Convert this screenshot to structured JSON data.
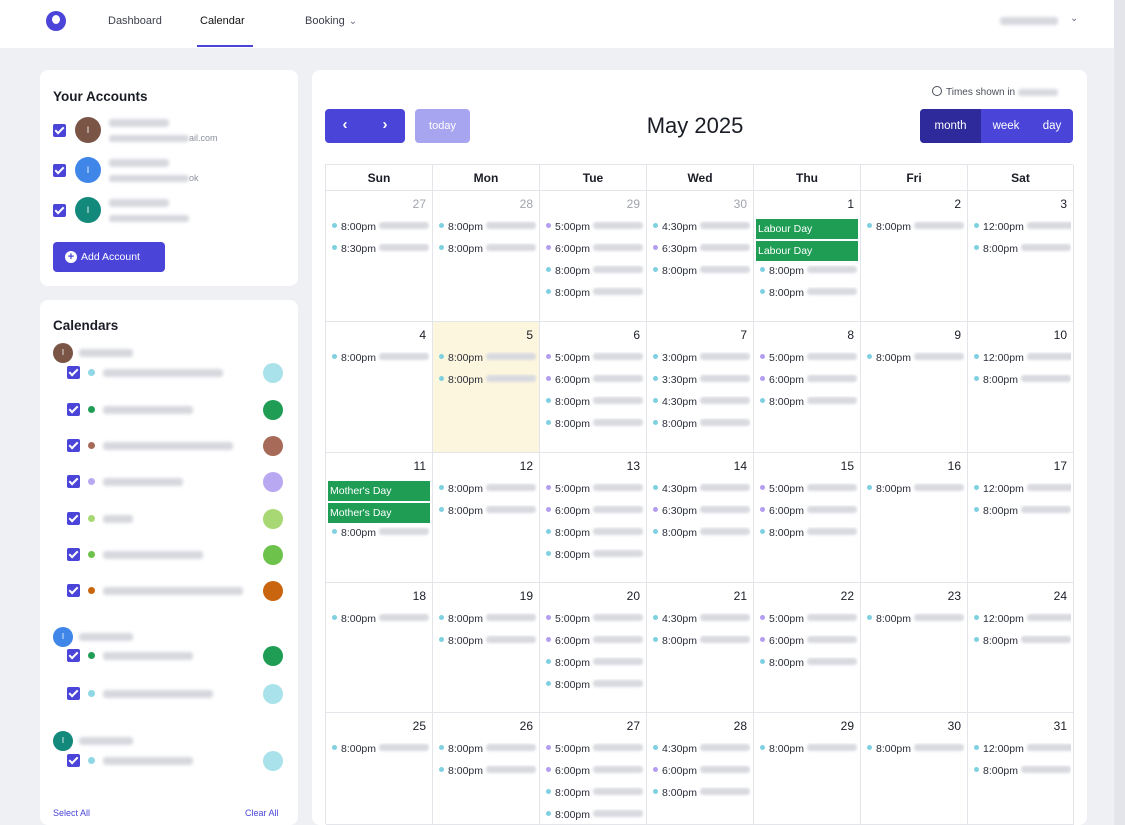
{
  "nav": {
    "dashboard": "Dashboard",
    "calendar": "Calendar",
    "booking": "Booking"
  },
  "accounts": {
    "title": "Your Accounts",
    "items": [
      {
        "initial": "I",
        "color": "#7a5546",
        "email_visible": "ail.com"
      },
      {
        "initial": "I",
        "color": "#3f86e8",
        "email_visible": "ok"
      },
      {
        "initial": "I",
        "color": "#12897b",
        "email_visible": ""
      }
    ],
    "add_label": "Add Account"
  },
  "calendars": {
    "title": "Calendars",
    "groups": [
      {
        "initial": "I",
        "color": "#7a5546",
        "items": [
          {
            "dot": "#8fd7e4",
            "swatch": "#a9e2ea"
          },
          {
            "dot": "#1f9d55",
            "swatch": "#1f9d55"
          },
          {
            "dot": "#a86a58",
            "swatch": "#a86a58"
          },
          {
            "dot": "#b8a8f2",
            "swatch": "#b8a8f2"
          },
          {
            "dot": "#a7d873",
            "swatch": "#a7d873"
          },
          {
            "dot": "#6cc24a",
            "swatch": "#6cc24a"
          },
          {
            "dot": "#c8650e",
            "swatch": "#c8650e"
          }
        ]
      },
      {
        "initial": "I",
        "color": "#3f86e8",
        "items": [
          {
            "dot": "#1f9d55",
            "swatch": "#1f9d55"
          },
          {
            "dot": "#8fd7e4",
            "swatch": "#a9e2ea"
          }
        ]
      },
      {
        "initial": "I",
        "color": "#12897b",
        "items": [
          {
            "dot": "#8fd7e4",
            "swatch": "#a9e2ea"
          }
        ]
      }
    ],
    "select_all": "Select All",
    "clear_all": "Clear All"
  },
  "toolbar": {
    "prev_icon": "chevron-left-icon",
    "next_icon": "chevron-right-icon",
    "prev_glyph": "‹",
    "next_glyph": "›",
    "today": "today",
    "month_title": "May 2025",
    "views": [
      "month",
      "week",
      "day"
    ],
    "active_view": "month",
    "tz_label": "Times shown in"
  },
  "colors": {
    "accent": "#4a45d8",
    "allday_green": "#1f9d55",
    "teal_dot": "#7fd0e0",
    "purple_dot": "#b39df0"
  },
  "weekdays": [
    "Sun",
    "Mon",
    "Tue",
    "Wed",
    "Thu",
    "Fri",
    "Sat"
  ],
  "weeks": [
    [
      {
        "day": "27",
        "other": true,
        "events": [
          {
            "t": "8:00pm",
            "c": "teal"
          },
          {
            "t": "8:30pm",
            "c": "teal"
          }
        ]
      },
      {
        "day": "28",
        "other": true,
        "events": [
          {
            "t": "8:00pm",
            "c": "teal"
          },
          {
            "t": "8:00pm",
            "c": "teal"
          }
        ]
      },
      {
        "day": "29",
        "other": true,
        "events": [
          {
            "t": "5:00pm",
            "c": "purple"
          },
          {
            "t": "6:00pm",
            "c": "purple"
          },
          {
            "t": "8:00pm",
            "c": "teal"
          },
          {
            "t": "8:00pm",
            "c": "teal"
          }
        ]
      },
      {
        "day": "30",
        "other": true,
        "events": [
          {
            "t": "4:30pm",
            "c": "teal"
          },
          {
            "t": "6:30pm",
            "c": "purple"
          },
          {
            "t": "8:00pm",
            "c": "teal"
          }
        ]
      },
      {
        "day": "1",
        "other": false,
        "allday": [
          "Labour Day",
          "Labour Day"
        ],
        "events": [
          {
            "t": "8:00pm",
            "c": "teal"
          },
          {
            "t": "8:00pm",
            "c": "teal"
          }
        ]
      },
      {
        "day": "2",
        "other": false,
        "events": [
          {
            "t": "8:00pm",
            "c": "teal"
          }
        ]
      },
      {
        "day": "3",
        "other": false,
        "events": [
          {
            "t": "12:00pm",
            "c": "teal"
          },
          {
            "t": "8:00pm",
            "c": "teal"
          }
        ]
      }
    ],
    [
      {
        "day": "4",
        "events": [
          {
            "t": "8:00pm",
            "c": "teal"
          }
        ]
      },
      {
        "day": "5",
        "today": true,
        "events": [
          {
            "t": "8:00pm",
            "c": "teal"
          },
          {
            "t": "8:00pm",
            "c": "teal"
          }
        ]
      },
      {
        "day": "6",
        "events": [
          {
            "t": "5:00pm",
            "c": "purple"
          },
          {
            "t": "6:00pm",
            "c": "purple"
          },
          {
            "t": "8:00pm",
            "c": "teal"
          },
          {
            "t": "8:00pm",
            "c": "teal"
          }
        ]
      },
      {
        "day": "7",
        "events": [
          {
            "t": "3:00pm",
            "c": "teal"
          },
          {
            "t": "3:30pm",
            "c": "teal"
          },
          {
            "t": "4:30pm",
            "c": "teal"
          },
          {
            "t": "8:00pm",
            "c": "teal"
          }
        ]
      },
      {
        "day": "8",
        "events": [
          {
            "t": "5:00pm",
            "c": "purple"
          },
          {
            "t": "6:00pm",
            "c": "purple"
          },
          {
            "t": "8:00pm",
            "c": "teal"
          }
        ]
      },
      {
        "day": "9",
        "events": [
          {
            "t": "8:00pm",
            "c": "teal"
          }
        ]
      },
      {
        "day": "10",
        "events": [
          {
            "t": "12:00pm",
            "c": "teal"
          },
          {
            "t": "8:00pm",
            "c": "teal"
          }
        ]
      }
    ],
    [
      {
        "day": "11",
        "allday": [
          "Mother's Day",
          "Mother's Day"
        ],
        "events": [
          {
            "t": "8:00pm",
            "c": "teal"
          }
        ]
      },
      {
        "day": "12",
        "events": [
          {
            "t": "8:00pm",
            "c": "teal"
          },
          {
            "t": "8:00pm",
            "c": "teal"
          }
        ]
      },
      {
        "day": "13",
        "events": [
          {
            "t": "5:00pm",
            "c": "purple"
          },
          {
            "t": "6:00pm",
            "c": "purple"
          },
          {
            "t": "8:00pm",
            "c": "teal"
          },
          {
            "t": "8:00pm",
            "c": "teal"
          }
        ]
      },
      {
        "day": "14",
        "events": [
          {
            "t": "4:30pm",
            "c": "teal"
          },
          {
            "t": "6:30pm",
            "c": "purple"
          },
          {
            "t": "8:00pm",
            "c": "teal"
          }
        ]
      },
      {
        "day": "15",
        "events": [
          {
            "t": "5:00pm",
            "c": "purple"
          },
          {
            "t": "6:00pm",
            "c": "purple"
          },
          {
            "t": "8:00pm",
            "c": "teal"
          }
        ]
      },
      {
        "day": "16",
        "events": [
          {
            "t": "8:00pm",
            "c": "teal"
          }
        ]
      },
      {
        "day": "17",
        "events": [
          {
            "t": "12:00pm",
            "c": "teal"
          },
          {
            "t": "8:00pm",
            "c": "teal"
          }
        ]
      }
    ],
    [
      {
        "day": "18",
        "events": [
          {
            "t": "8:00pm",
            "c": "teal"
          }
        ]
      },
      {
        "day": "19",
        "events": [
          {
            "t": "8:00pm",
            "c": "teal"
          },
          {
            "t": "8:00pm",
            "c": "teal"
          }
        ]
      },
      {
        "day": "20",
        "events": [
          {
            "t": "5:00pm",
            "c": "purple"
          },
          {
            "t": "6:00pm",
            "c": "purple"
          },
          {
            "t": "8:00pm",
            "c": "teal"
          },
          {
            "t": "8:00pm",
            "c": "teal"
          }
        ]
      },
      {
        "day": "21",
        "events": [
          {
            "t": "4:30pm",
            "c": "teal"
          },
          {
            "t": "8:00pm",
            "c": "teal"
          }
        ]
      },
      {
        "day": "22",
        "events": [
          {
            "t": "5:00pm",
            "c": "purple"
          },
          {
            "t": "6:00pm",
            "c": "purple"
          },
          {
            "t": "8:00pm",
            "c": "teal"
          }
        ]
      },
      {
        "day": "23",
        "events": [
          {
            "t": "8:00pm",
            "c": "teal"
          }
        ]
      },
      {
        "day": "24",
        "events": [
          {
            "t": "12:00pm",
            "c": "teal"
          },
          {
            "t": "8:00pm",
            "c": "teal"
          }
        ]
      }
    ],
    [
      {
        "day": "25",
        "events": [
          {
            "t": "8:00pm",
            "c": "teal"
          }
        ]
      },
      {
        "day": "26",
        "events": [
          {
            "t": "8:00pm",
            "c": "teal"
          },
          {
            "t": "8:00pm",
            "c": "teal"
          }
        ]
      },
      {
        "day": "27",
        "events": [
          {
            "t": "5:00pm",
            "c": "purple"
          },
          {
            "t": "6:00pm",
            "c": "purple"
          },
          {
            "t": "8:00pm",
            "c": "teal"
          },
          {
            "t": "8:00pm",
            "c": "teal"
          }
        ]
      },
      {
        "day": "28",
        "events": [
          {
            "t": "4:30pm",
            "c": "teal"
          },
          {
            "t": "6:00pm",
            "c": "purple"
          },
          {
            "t": "8:00pm",
            "c": "teal"
          }
        ]
      },
      {
        "day": "29",
        "events": [
          {
            "t": "8:00pm",
            "c": "teal"
          }
        ]
      },
      {
        "day": "30",
        "events": [
          {
            "t": "8:00pm",
            "c": "teal"
          }
        ]
      },
      {
        "day": "31",
        "events": [
          {
            "t": "12:00pm",
            "c": "teal"
          },
          {
            "t": "8:00pm",
            "c": "teal"
          }
        ]
      }
    ]
  ]
}
